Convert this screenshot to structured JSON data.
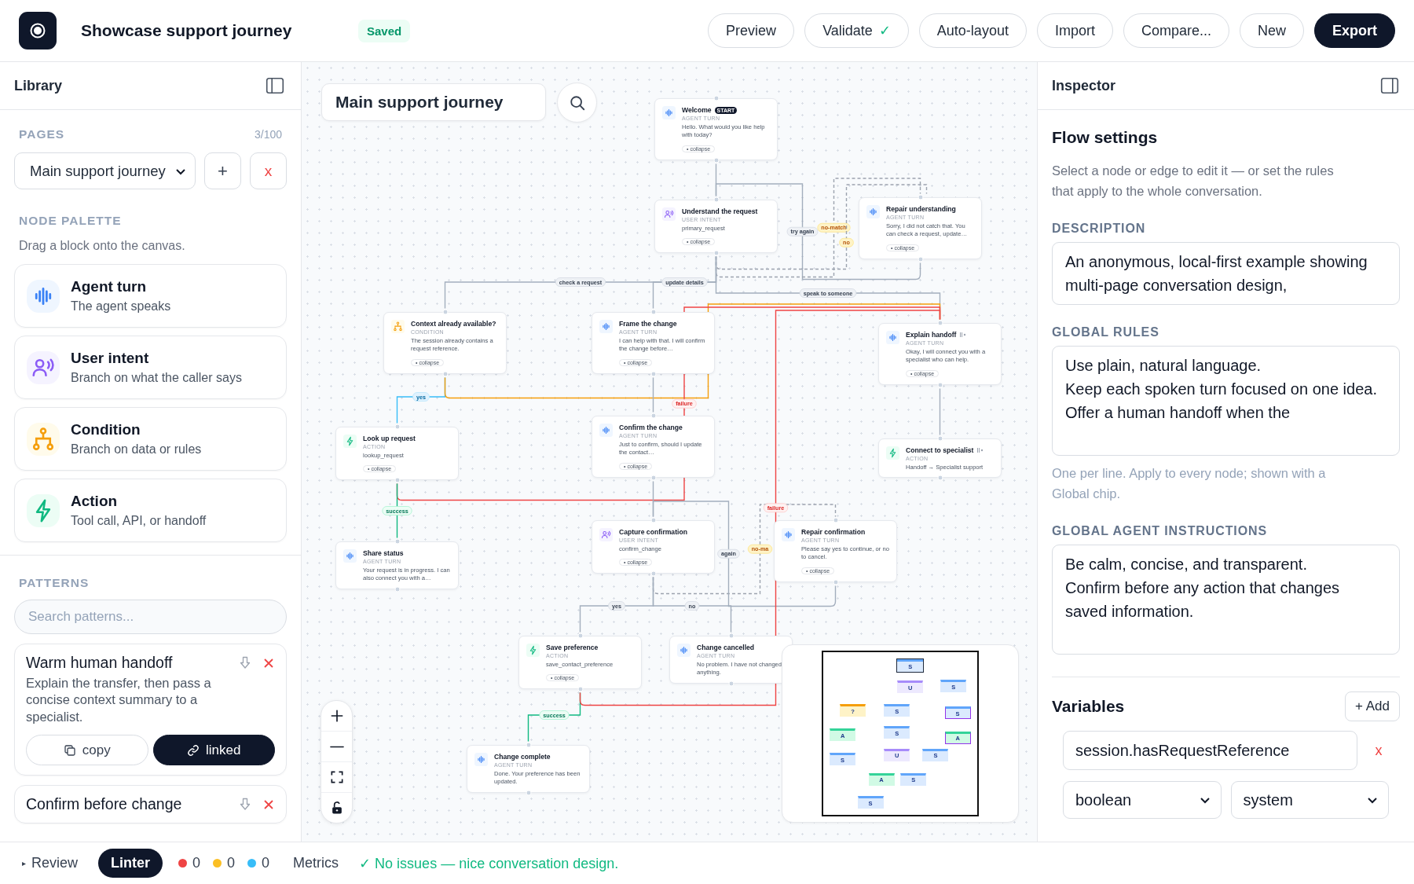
{
  "app": {
    "title": "Showcase support journey",
    "status": "Saved"
  },
  "toolbar": [
    {
      "label": "Preview",
      "kind": "plain"
    },
    {
      "label": "Validate",
      "kind": "check",
      "suffix": "✓"
    },
    {
      "label": "Auto-layout",
      "kind": "plain"
    },
    {
      "label": "Import",
      "kind": "plain"
    },
    {
      "label": "Compare...",
      "kind": "plain"
    },
    {
      "label": "New",
      "kind": "plain"
    },
    {
      "label": "Export",
      "kind": "primary"
    }
  ],
  "library": {
    "title": "Library",
    "pages": {
      "heading": "PAGES",
      "count": "3/100",
      "current": "Main support journey",
      "add": "+",
      "remove": "x"
    },
    "palette": {
      "heading": "NODE PALETTE",
      "hint": "Drag a block onto the canvas.",
      "items": [
        {
          "kind": "agent",
          "title": "Agent turn",
          "subtitle": "The agent speaks"
        },
        {
          "kind": "intent",
          "title": "User intent",
          "subtitle": "Branch on what the caller says"
        },
        {
          "kind": "condition",
          "title": "Condition",
          "subtitle": "Branch on data or rules"
        },
        {
          "kind": "action",
          "title": "Action",
          "subtitle": "Tool call, API, or handoff"
        }
      ]
    },
    "patterns": {
      "heading": "PATTERNS",
      "placeholder": "Search patterns...",
      "items": [
        {
          "title": "Warm human handoff",
          "description": "Explain the transfer, then pass a concise context summary to a specialist.",
          "buttons": [
            {
              "label": "copy",
              "kind": "copy",
              "selected": false
            },
            {
              "label": "linked",
              "kind": "link",
              "selected": true
            }
          ]
        },
        {
          "title": "Confirm before change"
        }
      ]
    }
  },
  "canvas": {
    "title_field": "Main support journey",
    "nodes": [
      {
        "kind": "agent",
        "title": "Welcome",
        "badge": "START",
        "type_label": "AGENT TURN",
        "text": "Hello. What would you like help with today?",
        "chip": "• collapse",
        "linked": false
      },
      {
        "kind": "intent",
        "title": "Understand the request",
        "type_label": "USER INTENT",
        "text": "primary_request",
        "chip": "• collapse",
        "linked": false
      },
      {
        "kind": "agent",
        "title": "Repair understanding",
        "type_label": "AGENT TURN",
        "text": "Sorry, I did not catch that. You can check a request, update…",
        "chip": "• collapse",
        "linked": false
      },
      {
        "kind": "condition",
        "title": "Context already available?",
        "type_label": "CONDITION",
        "text": "The session already contains a request reference.",
        "chip": "• collapse",
        "linked": false
      },
      {
        "kind": "agent",
        "title": "Frame the change",
        "type_label": "AGENT TURN",
        "text": "I can help with that. I will confirm the change before…",
        "chip": "• collapse",
        "linked": false
      },
      {
        "kind": "agent",
        "title": "Explain handoff",
        "type_label": "AGENT TURN",
        "text": "Okay, I will connect you with a specialist who can help.",
        "chip": "• collapse",
        "linked": true
      },
      {
        "kind": "action",
        "title": "Look up request",
        "type_label": "ACTION",
        "text": "lookup_request",
        "chip": "• collapse",
        "linked": false
      },
      {
        "kind": "agent",
        "title": "Confirm the change",
        "type_label": "AGENT TURN",
        "text": "Just to confirm, should I update the contact…",
        "chip": "• collapse",
        "linked": false
      },
      {
        "kind": "action",
        "title": "Connect to specialist",
        "type_label": "ACTION",
        "text": "Handoff → Specialist support",
        "linked": true
      },
      {
        "kind": "agent",
        "title": "Share status",
        "type_label": "AGENT TURN",
        "text": "Your request is in progress. I can also connect you with a…",
        "linked": false
      },
      {
        "kind": "intent",
        "title": "Capture confirmation",
        "type_label": "USER INTENT",
        "text": "confirm_change",
        "chip": "• collapse",
        "linked": false
      },
      {
        "kind": "agent",
        "title": "Repair confirmation",
        "type_label": "AGENT TURN",
        "text": "Please say yes to continue, or no to cancel.",
        "chip": "• collapse",
        "linked": false
      },
      {
        "kind": "action",
        "title": "Save preference",
        "type_label": "ACTION",
        "text": "save_contact_preference",
        "chip": "• collapse",
        "linked": false
      },
      {
        "kind": "agent",
        "title": "Change cancelled",
        "type_label": "AGENT TURN",
        "text": "No problem. I have not changed anything.",
        "linked": false
      },
      {
        "kind": "agent",
        "title": "Change complete",
        "type_label": "AGENT TURN",
        "text": "Done. Your preference has been updated.",
        "linked": false
      }
    ],
    "edges": [
      {
        "kind": "plain"
      },
      {
        "kind": "plain",
        "label": "try again"
      },
      {
        "kind": "nomatch",
        "label": "no-match"
      },
      {
        "kind": "nomatch",
        "label": "no"
      },
      {
        "kind": "plain",
        "label": "check a request"
      },
      {
        "kind": "plain",
        "label": "update details"
      },
      {
        "kind": "plain",
        "label": "speak to someone"
      },
      {
        "kind": "yes",
        "label": "yes"
      },
      {
        "kind": "else"
      },
      {
        "kind": "plain"
      },
      {
        "kind": "failure",
        "label": "failure"
      },
      {
        "kind": "success",
        "label": "success"
      },
      {
        "kind": "plain"
      },
      {
        "kind": "nomatch",
        "label": "no-ma"
      },
      {
        "kind": "plain",
        "label": "again"
      },
      {
        "kind": "plain",
        "label": "yes"
      },
      {
        "kind": "plain",
        "label": "no"
      },
      {
        "kind": "success",
        "label": "success"
      },
      {
        "kind": "failure",
        "label": "failure"
      },
      {
        "kind": "plain"
      }
    ],
    "minimap": {
      "marks": [
        "S",
        "U",
        "S",
        "?",
        "S",
        "S",
        "A",
        "S",
        "A",
        "S",
        "U",
        "S",
        "A",
        "S",
        "S"
      ]
    }
  },
  "inspector": {
    "title": "Inspector",
    "heading": "Flow settings",
    "intro": "Select a node or edge to edit it — or set the rules that apply to the whole conversation.",
    "fields": [
      {
        "label": "DESCRIPTION",
        "value": "An anonymous, local-first example showing multi-page conversation design,"
      },
      {
        "label": "GLOBAL RULES",
        "value": "Use plain, natural language.\nKeep each spoken turn focused on one idea.\nOffer a human handoff when the",
        "hint": "One per line. Apply to every node; shown with a Global chip."
      },
      {
        "label": "GLOBAL AGENT INSTRUCTIONS",
        "value": "Be calm, concise, and transparent.\nConfirm before any action that changes saved information."
      }
    ],
    "variables": {
      "heading": "Variables",
      "add": "+ Add",
      "items": [
        {
          "name": "session.hasRequestReference",
          "remove": "x",
          "type": "boolean",
          "scope": "system"
        }
      ]
    }
  },
  "status_bar": {
    "toggle": "▸",
    "review": "Review",
    "tab": "Linter",
    "counts": [
      {
        "color": "#ef4444",
        "count": "0"
      },
      {
        "color": "#fbbf24",
        "count": "0"
      },
      {
        "color": "#38bdf8",
        "count": "0"
      }
    ],
    "metrics": "Metrics",
    "message": "✓ No issues — nice conversation design."
  }
}
